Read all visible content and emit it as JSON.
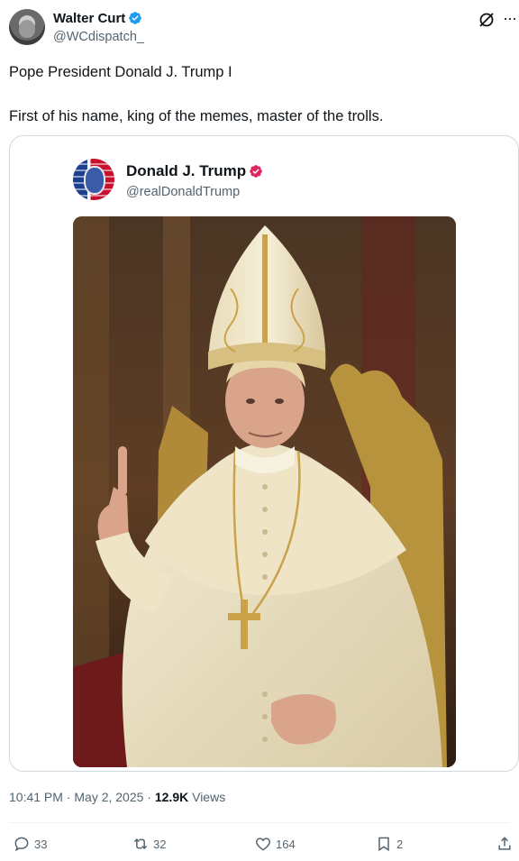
{
  "author": {
    "name": "Walter Curt",
    "handle": "@WCdispatch_"
  },
  "tweet": {
    "line1": "Pope President Donald J. Trump I",
    "line2": "First of his name, king of the memes, master of the trolls."
  },
  "quoted": {
    "name": "Donald J. Trump",
    "handle": "@realDonaldTrump"
  },
  "meta": {
    "time": "10:41 PM · May 2, 2025 · ",
    "views_count": "12.9K",
    "views_label": " Views"
  },
  "actions": {
    "replies": "33",
    "reposts": "32",
    "likes": "164",
    "bookmarks": "2"
  },
  "colors": {
    "verified_blue": "#1d9bf0",
    "verified_gold": "#e0245e",
    "text_primary": "#0f1419",
    "text_secondary": "#536471"
  },
  "icons": [
    "verified-icon",
    "grok-icon",
    "more-icon",
    "reply-icon",
    "repost-icon",
    "like-icon",
    "bookmark-icon",
    "share-icon"
  ]
}
